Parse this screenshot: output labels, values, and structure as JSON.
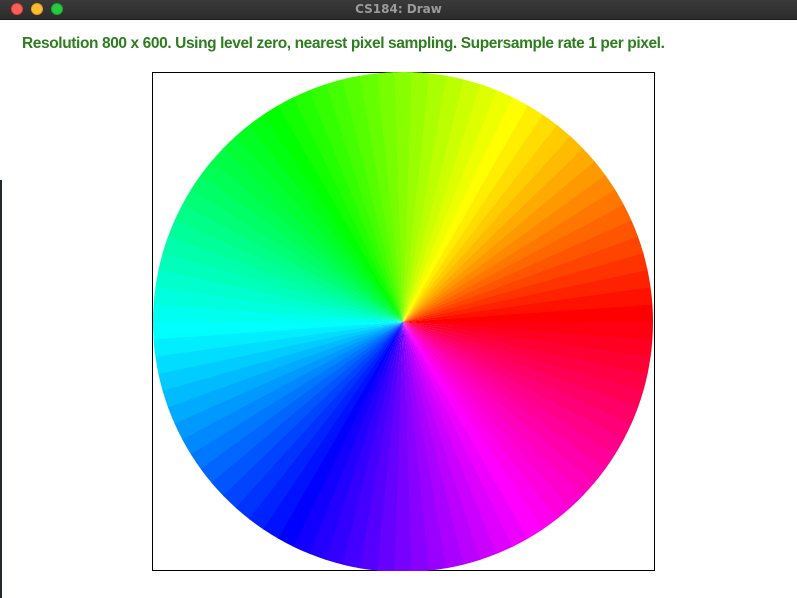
{
  "window": {
    "title": "CS184: Draw"
  },
  "status": {
    "text": "Resolution 800 x 600. Using level zero, nearest pixel sampling. Supersample rate 1 per pixel."
  },
  "colors": {
    "status_text": "#2e7d1f",
    "titlebar": "#2c2c2c",
    "close": "#fe5f57",
    "minimize": "#febc2e",
    "zoom": "#28c840"
  },
  "color_wheel": {
    "segments": 90,
    "start_hue_at_right": "red",
    "direction": "counterclockwise"
  }
}
